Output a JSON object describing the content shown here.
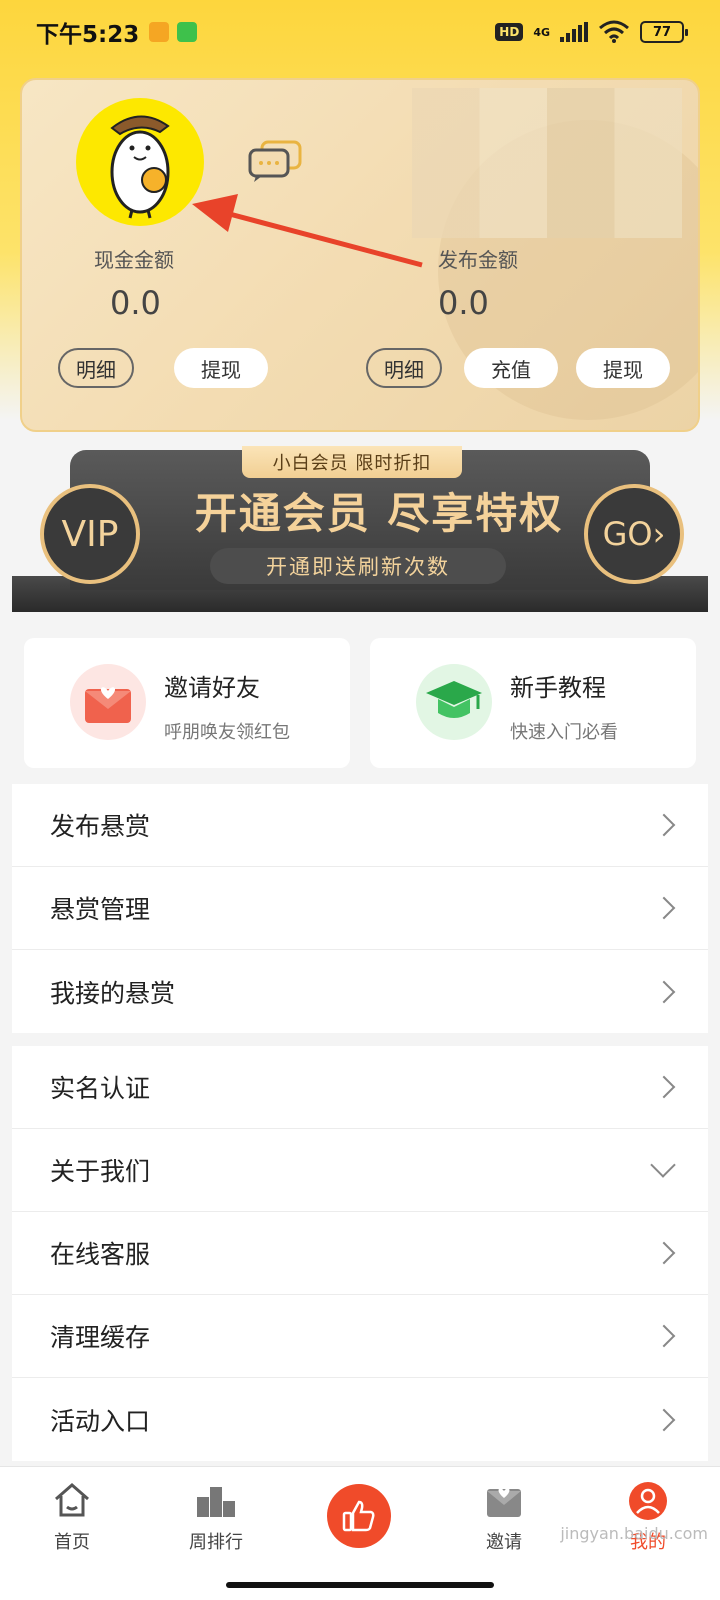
{
  "status_bar": {
    "time": "下午5:23",
    "network": "4G",
    "battery": "77"
  },
  "wallet": {
    "cash_label": "现金金额",
    "cash_value": "0.0",
    "publish_label": "发布金额",
    "publish_value": "0.0",
    "cash_detail": "明细",
    "cash_withdraw": "提现",
    "publish_detail": "明细",
    "publish_recharge": "充值",
    "publish_withdraw": "提现"
  },
  "vip": {
    "tag": "小白会员 限时折扣",
    "left_badge": "VIP",
    "title": "开通会员 尽享特权",
    "subtitle": "开通即送刷新次数",
    "go": "GO›"
  },
  "quick": [
    {
      "title": "邀请好友",
      "subtitle": "呼朋唤友领红包",
      "icon": "envelope-heart-icon"
    },
    {
      "title": "新手教程",
      "subtitle": "快速入门必看",
      "icon": "graduation-cap-icon"
    }
  ],
  "menu_group1": [
    {
      "label": "发布悬赏"
    },
    {
      "label": "悬赏管理"
    },
    {
      "label": "我接的悬赏"
    }
  ],
  "menu_group2": [
    {
      "label": "实名认证"
    },
    {
      "label": "关于我们"
    },
    {
      "label": "在线客服"
    },
    {
      "label": "清理缓存"
    },
    {
      "label": "活动入口"
    }
  ],
  "nav": [
    {
      "label": "首页",
      "icon": "home-icon"
    },
    {
      "label": "周排行",
      "icon": "podium-icon"
    },
    {
      "label": "",
      "icon": "thumbs-up-icon"
    },
    {
      "label": "邀请",
      "icon": "invite-envelope-icon"
    },
    {
      "label": "我的",
      "icon": "profile-icon"
    }
  ],
  "watermark": "jingyan.baidu.com",
  "colors": {
    "accent": "#f04b2a",
    "yellow": "#fdd63d",
    "gold": "#f3d39c"
  }
}
